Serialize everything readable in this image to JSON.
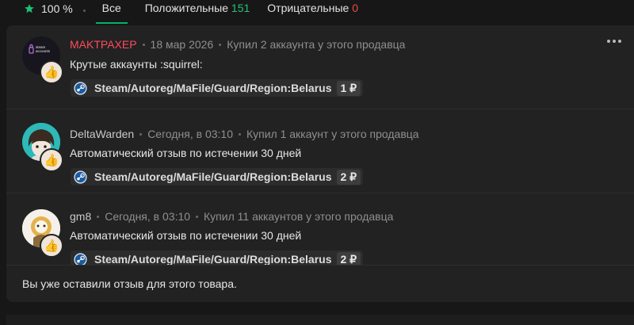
{
  "header": {
    "rating_percent": "100 %",
    "tabs": [
      {
        "label": "Все",
        "count": ""
      },
      {
        "label": "Положительные",
        "count": "151"
      },
      {
        "label": "Отрицательные",
        "count": "0"
      }
    ]
  },
  "reviews": [
    {
      "name": "MAKTPAXEP",
      "date": "18 мар 2026",
      "purchase": "Купил 2 аккаунта у этого продавца",
      "text": "Крутые аккаунты :squirrel:",
      "product": "Steam/Autoreg/MaFile/Guard/Region:Belarus",
      "price": "1 ₽",
      "avatar_text": "steam accounts"
    },
    {
      "name": "DeltaWarden",
      "date": "Сегодня, в 03:10",
      "purchase": "Купил 1 аккаунт у этого продавца",
      "text": "Автоматический отзыв по истечении 30 дней",
      "product": "Steam/Autoreg/MaFile/Guard/Region:Belarus",
      "price": "2 ₽"
    },
    {
      "name": "gm8",
      "date": "Сегодня, в 03:10",
      "purchase": "Купил 11 аккаунтов у этого продавца",
      "text": "Автоматический отзыв по истечении 30 дней",
      "product": "Steam/Autoreg/MaFile/Guard/Region:Belarus",
      "price": "2 ₽"
    }
  ],
  "footer": {
    "message": "Вы уже оставили отзыв для этого товара."
  },
  "colors": {
    "accent": "#00b46e",
    "positive": "#27c07a",
    "negative": "#ec4a4a",
    "highlight_name": "#ff4b5c"
  }
}
